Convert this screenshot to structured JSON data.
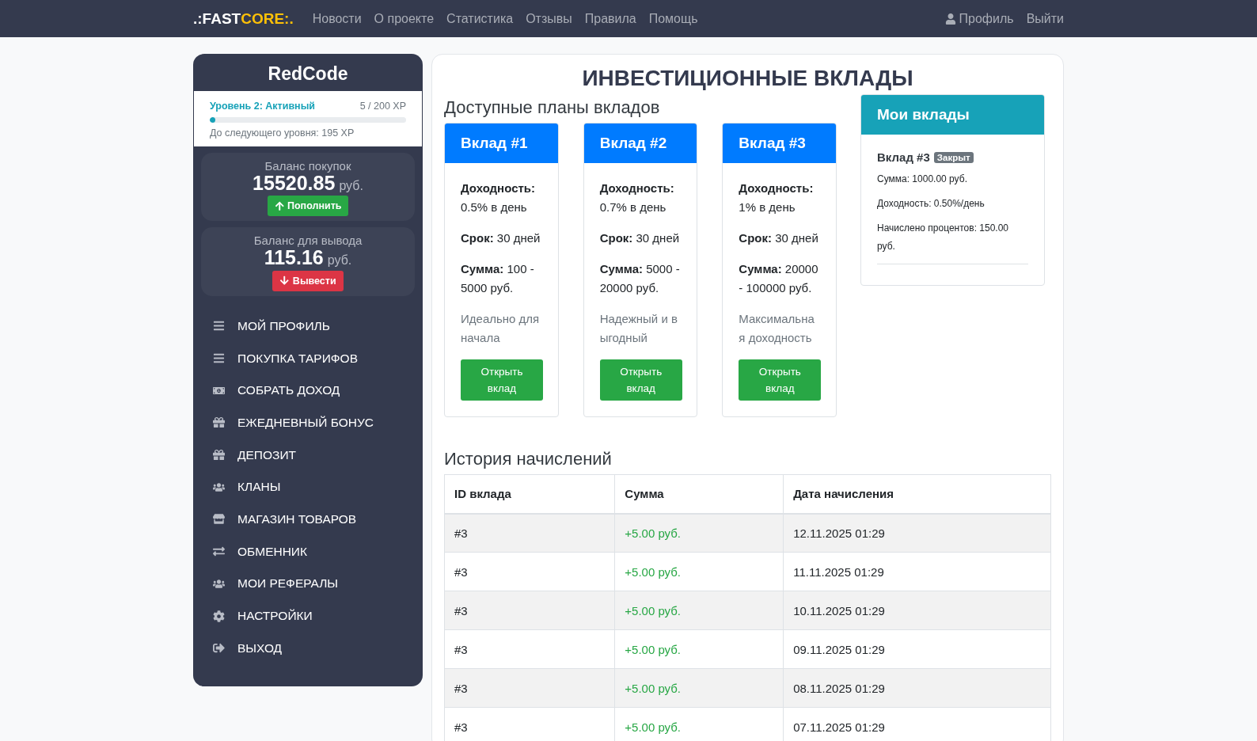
{
  "navbar": {
    "logo": {
      "prefix": ".:FAST",
      "accent": "CORE:."
    },
    "links": [
      "Новости",
      "О проекте",
      "Статистика",
      "Отзывы",
      "Правила",
      "Помощь"
    ],
    "profile": "Профиль",
    "logout": "Выйти"
  },
  "sidebar": {
    "username": "RedCode",
    "level": {
      "title": "Уровень 2: Активный",
      "xp": "5 / 200 XP",
      "level": 0.03,
      "next": "До следующего уровня: 195 XP"
    },
    "balances": [
      {
        "kind": "deposit",
        "label": "Баланс покупок",
        "amount": "15520.85",
        "currency": "руб.",
        "button": "Пополнить"
      },
      {
        "kind": "withdraw",
        "label": "Баланс для вывода",
        "amount": "115.16",
        "currency": "руб.",
        "button": "Вывести"
      }
    ],
    "menu": [
      "МОЙ ПРОФИЛЬ",
      "ПОКУПКА ТАРИФОВ",
      "СОБРАТЬ ДОХОД",
      "ЕЖЕДНЕВНЫЙ БОНУС",
      "ДЕПОЗИТ",
      "КЛАНЫ",
      "МАГАЗИН ТОВАРОВ",
      "ОБМЕННИК",
      "МОИ РЕФЕРАЛЫ",
      "НАСТРОЙКИ",
      "ВЫХОД"
    ]
  },
  "page_title": "ИНВЕСТИЦИОННЫЕ ВКЛАДЫ",
  "plans": {
    "title": "Доступные планы вкладов",
    "items": [
      {
        "name": "Вклад #1",
        "yield_label": "Доходность:",
        "yield": "0.5% в день",
        "term_label": "Срок:",
        "term": "30 дней",
        "sum_label": "Сумма:",
        "sum": "100 - 5000 руб.",
        "note": "Идеально для начала",
        "button": "Открыть вклад"
      },
      {
        "name": "Вклад #2",
        "yield_label": "Доходность:",
        "yield": "0.7% в день",
        "term_label": "Срок:",
        "term": "30 дней",
        "sum_label": "Сумма:",
        "sum": "5000 - 20000 руб.",
        "note": "Надежный и выгодный",
        "button": "Открыть вклад"
      },
      {
        "name": "Вклад #3",
        "yield_label": "Доходность:",
        "yield": "1% в день",
        "term_label": "Срок:",
        "term": "30 дней",
        "sum_label": "Сумма:",
        "sum": "20000 - 100000 руб.",
        "note": "Максимальная доходность",
        "button": "Открыть вклад"
      }
    ]
  },
  "my_deposits": {
    "title": "Мои вклады",
    "items": [
      {
        "name": "Вклад #3",
        "status": "Закрыт",
        "lines": [
          "Сумма: 1000.00 руб.",
          "Доходность: 0.50%/день",
          "Начислено процентов: 150.00 руб."
        ]
      }
    ]
  },
  "history": {
    "title": "История начислений",
    "columns": [
      "ID вклада",
      "Сумма",
      "Дата начисления"
    ],
    "rows": [
      [
        "#3",
        "+5.00 руб.",
        "12.11.2025 01:29"
      ],
      [
        "#3",
        "+5.00 руб.",
        "11.11.2025 01:29"
      ],
      [
        "#3",
        "+5.00 руб.",
        "10.11.2025 01:29"
      ],
      [
        "#3",
        "+5.00 руб.",
        "09.11.2025 01:29"
      ],
      [
        "#3",
        "+5.00 руб.",
        "08.11.2025 01:29"
      ],
      [
        "#3",
        "+5.00 руб.",
        "07.11.2025 01:29"
      ]
    ]
  }
}
